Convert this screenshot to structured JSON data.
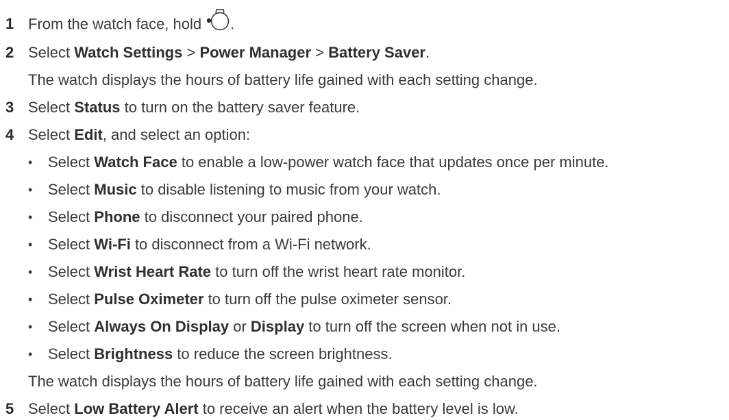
{
  "steps": [
    {
      "num": "1",
      "pre": "From the watch face, hold ",
      "post": "."
    },
    {
      "num": "2",
      "pre": "Select ",
      "b1": "Watch Settings",
      "sep1": " > ",
      "b2": "Power Manager",
      "sep2": " > ",
      "b3": "Battery Saver",
      "post": ".",
      "note": "The watch displays the hours of battery life gained with each setting change."
    },
    {
      "num": "3",
      "pre": "Select ",
      "b1": "Status",
      "post": " to turn on the battery saver feature."
    },
    {
      "num": "4",
      "pre": "Select ",
      "b1": "Edit",
      "post": ", and select an option:",
      "note": "The watch displays the hours of battery life gained with each setting change."
    },
    {
      "num": "5",
      "pre": "Select ",
      "b1": "Low Battery Alert",
      "post": " to receive an alert when the battery level is low."
    }
  ],
  "bullet_glyph": "•",
  "options": [
    {
      "pre": "Select ",
      "b1": "Watch Face",
      "post": " to enable a low-power watch face that updates once per minute."
    },
    {
      "pre": "Select ",
      "b1": "Music",
      "post": " to disable listening to music from your watch."
    },
    {
      "pre": "Select ",
      "b1": "Phone",
      "post": " to disconnect your paired phone."
    },
    {
      "pre": "Select ",
      "b1": "Wi-Fi",
      "post": " to disconnect from a Wi-Fi network."
    },
    {
      "pre": "Select ",
      "b1": "Wrist Heart Rate",
      "post": " to turn off the wrist heart rate monitor."
    },
    {
      "pre": "Select ",
      "b1": "Pulse Oximeter",
      "post": " to turn off the pulse oximeter sensor."
    },
    {
      "pre": "Select ",
      "b1": "Always On Display",
      "mid": " or ",
      "b2": "Display",
      "post": " to turn off the screen when not in use."
    },
    {
      "pre": "Select ",
      "b1": "Brightness",
      "post": " to reduce the screen brightness."
    }
  ],
  "icons": {
    "hold_button": "watch-button-icon"
  }
}
